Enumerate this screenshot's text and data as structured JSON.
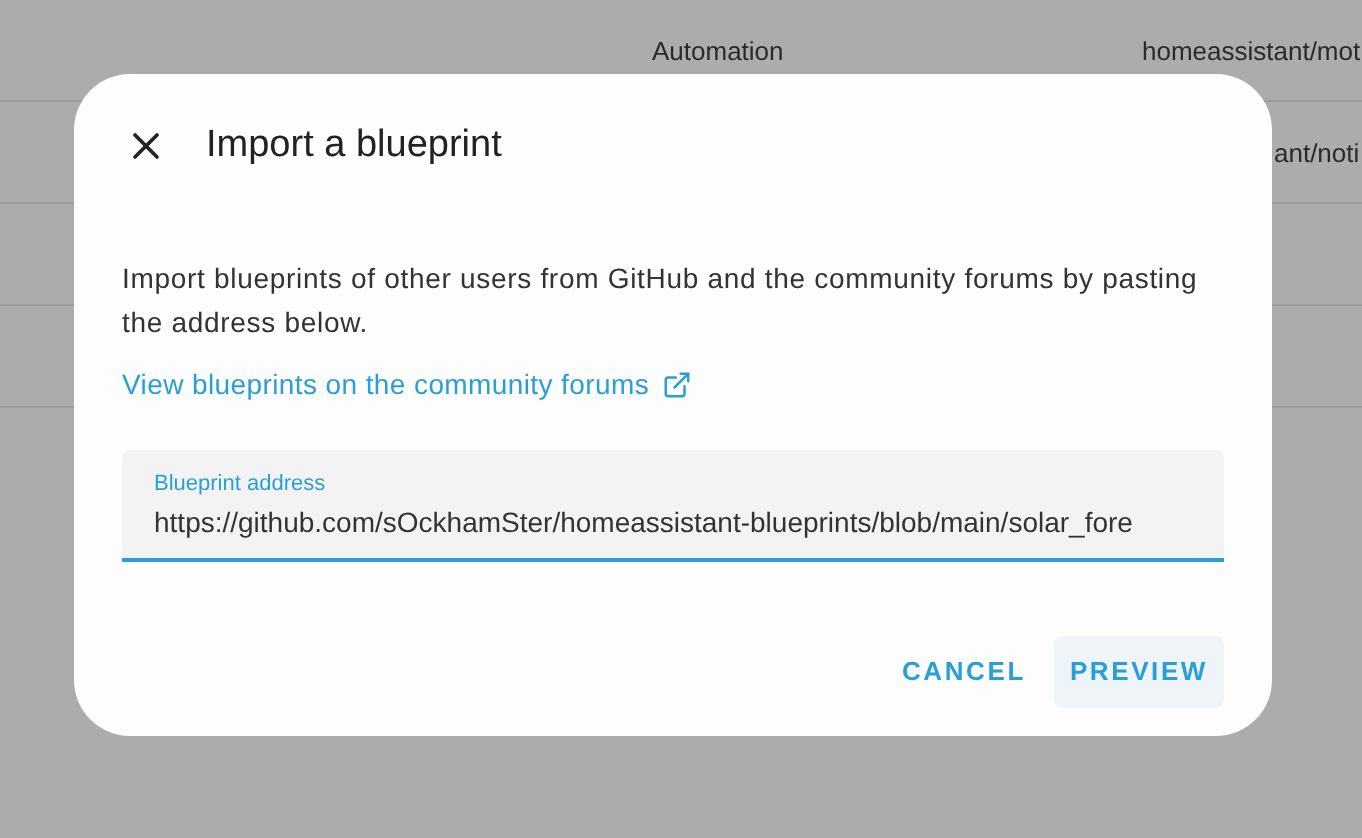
{
  "background_table": {
    "rows": [
      {
        "column_2": "Automation",
        "column_3": "homeassistant/mot"
      },
      {
        "column_3": "ant/noti"
      },
      {},
      {}
    ]
  },
  "dialog": {
    "title": "Import a blueprint",
    "description": "Import blueprints of other users from GitHub and the community forums by pasting the address below.",
    "link": "View blueprints on the community forums",
    "field": {
      "label": "Blueprint address",
      "value": "https://github.com/sOckhamSter/homeassistant-blueprints/blob/main/solar_fore"
    },
    "buttons": [
      {
        "label": "CANCEL",
        "hovered": false
      },
      {
        "label": "PREVIEW",
        "hovered": true
      }
    ]
  }
}
